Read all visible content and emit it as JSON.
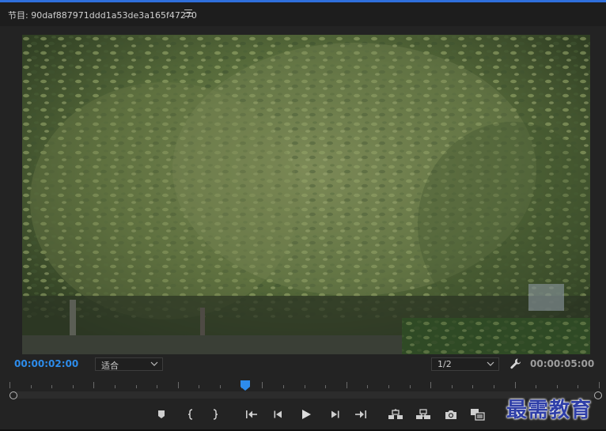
{
  "panel": {
    "title": "节目: 90daf887971ddd1a53de3a165f47270"
  },
  "viewer": {
    "content": "video-frame-tree"
  },
  "controls": {
    "current_time": "00:00:02:00",
    "zoom_value": "适合",
    "resolution_value": "1/2",
    "duration": "00:00:05:00"
  },
  "playback": {
    "position_fraction": 0.4
  },
  "transport": {
    "buttons": [
      {
        "name": "add-marker-button",
        "icon": "marker-icon"
      },
      {
        "name": "mark-in-button",
        "icon": "mark-in-icon"
      },
      {
        "name": "mark-out-button",
        "icon": "mark-out-icon"
      },
      {
        "name": "go-to-in-button",
        "icon": "go-to-in-icon"
      },
      {
        "name": "step-back-button",
        "icon": "step-back-icon"
      },
      {
        "name": "play-button",
        "icon": "play-icon"
      },
      {
        "name": "step-forward-button",
        "icon": "step-forward-icon"
      },
      {
        "name": "go-to-out-button",
        "icon": "go-to-out-icon"
      },
      {
        "name": "lift-button",
        "icon": "lift-icon"
      },
      {
        "name": "extract-button",
        "icon": "extract-icon"
      },
      {
        "name": "export-frame-button",
        "icon": "camera-icon"
      },
      {
        "name": "comparison-view-button",
        "icon": "comparison-icon"
      }
    ]
  },
  "watermark": {
    "text": "最需教育"
  },
  "colors": {
    "accent": "#2d8ceb",
    "panel_bg": "#232323",
    "header_bg": "#1d1d1d"
  }
}
